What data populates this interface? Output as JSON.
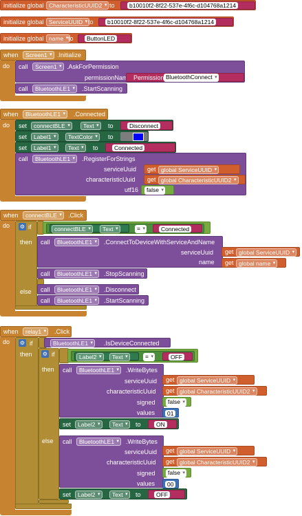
{
  "globals": [
    {
      "kw": "initialize global",
      "name": "CharacteristicUUID2",
      "to": "to",
      "value": "b10010f2-8f22-537e-4f6c-d104768a1214"
    },
    {
      "kw": "initialize global",
      "name": "ServiceUUID",
      "to": "to",
      "value": "b10010f2-8f22-537e-4f6c-d104768a1214"
    },
    {
      "kw": "initialize global",
      "name": "name",
      "to": "to",
      "value": "ButtonLED"
    }
  ],
  "kw": {
    "when": "when",
    "do": "do",
    "call": "call",
    "set": "set",
    "to": "to",
    "get": "get",
    "if": "if",
    "then": "then",
    "else": "else"
  },
  "ev1": {
    "component": "Screen1",
    "event": ".Initialize",
    "ask": {
      "component": "Screen1",
      "method": ".AskForPermission",
      "param": "permissionName",
      "perm_kw": "Permission",
      "perm": "BluetoothConnect"
    },
    "scan": {
      "component": "BluetoothLE1",
      "method": ".StartScanning"
    }
  },
  "ev2": {
    "component": "BluetoothLE1",
    "event": ".Connected",
    "s1": {
      "component": "connectBLE",
      "prop": "Text",
      "value": "Disconnect"
    },
    "s2": {
      "component": "Label1",
      "prop": "TextColor",
      "color": "#0000ff"
    },
    "s3": {
      "component": "Label1",
      "prop": "Text",
      "value": "Connected"
    },
    "reg": {
      "component": "BluetoothLE1",
      "method": ".RegisterForStrings",
      "p1": "serviceUuid",
      "v1": "global ServiceUUID",
      "p2": "characteristicUuid",
      "v2": "global CharacteristicUUID2",
      "p3": "utf16",
      "v3": "false"
    }
  },
  "ev3": {
    "component": "connectBLE",
    "event": ".Click",
    "cond": {
      "component": "connectBLE",
      "prop": "Text",
      "op": "=",
      "value": "Connected"
    },
    "conn": {
      "component": "BluetoothLE1",
      "method": ".ConnectToDeviceWithServiceAndName",
      "p1": "serviceUuid",
      "v1": "global ServiceUUID",
      "p2": "name",
      "v2": "global name"
    },
    "stop": {
      "component": "BluetoothLE1",
      "method": ".StopScanning"
    },
    "disc": {
      "component": "BluetoothLE1",
      "method": ".Disconnect"
    },
    "start": {
      "component": "BluetoothLE1",
      "method": ".StartScanning"
    }
  },
  "ev4": {
    "component": "relay1",
    "event": ".Click",
    "cond1": {
      "component": "BluetoothLE1",
      "method": ".IsDeviceConnected"
    },
    "cond2": {
      "component": "Label2",
      "prop": "Text",
      "op": "=",
      "value": "OFF"
    },
    "w1": {
      "component": "BluetoothLE1",
      "method": ".WriteBytes",
      "p1": "serviceUuid",
      "v1": "global ServiceUUID",
      "p2": "characteristicUuid",
      "v2": "global CharacteristicUUID2",
      "p3": "signed",
      "v3": "false",
      "p4": "values",
      "v4": "01"
    },
    "s1": {
      "component": "Label2",
      "prop": "Text",
      "value": "ON"
    },
    "w2": {
      "component": "BluetoothLE1",
      "method": ".WriteBytes",
      "p1": "serviceUuid",
      "v1": "global ServiceUUID",
      "p2": "characteristicUuid",
      "v2": "global CharacteristicUUID2",
      "p3": "signed",
      "v3": "false",
      "p4": "values",
      "v4": "00"
    },
    "s2": {
      "component": "Label2",
      "prop": "Text",
      "value": "OFF"
    }
  }
}
